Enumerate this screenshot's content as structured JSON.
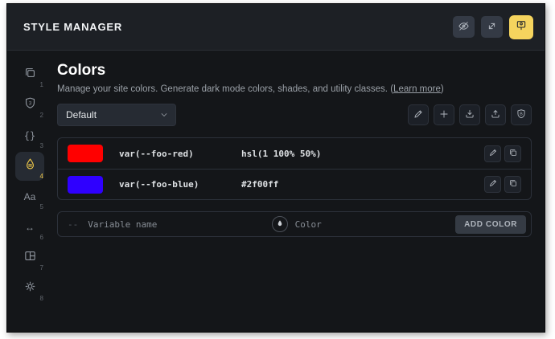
{
  "window": {
    "title": "STYLE MANAGER"
  },
  "topbar": {
    "buttons": [
      {
        "icon": "eye-off-icon",
        "active": false
      },
      {
        "icon": "expand-icon",
        "active": false
      },
      {
        "icon": "brush-icon",
        "active": true
      }
    ]
  },
  "sidebar": {
    "items": [
      {
        "icon": "layers-copy-icon",
        "number": "1"
      },
      {
        "icon": "shield-3-icon",
        "number": "2"
      },
      {
        "icon": "braces-icon",
        "glyph": "{}",
        "number": "3"
      },
      {
        "icon": "droplet-icon",
        "number": "4",
        "active": true
      },
      {
        "icon": "typography-icon",
        "glyph": "Aa",
        "number": "5"
      },
      {
        "icon": "spacing-icon",
        "glyph": "↔",
        "number": "6"
      },
      {
        "icon": "grid-icon",
        "number": "7"
      },
      {
        "icon": "gear-icon",
        "number": "8"
      }
    ]
  },
  "main": {
    "title": "Colors",
    "description_prefix": "Manage your site colors. Generate dark mode colors, shades, and utility classes. (",
    "learn_more": "Learn more",
    "description_suffix": ")",
    "theme_select": {
      "value": "Default"
    },
    "tools": [
      "pencil-icon",
      "plus-icon",
      "import-icon",
      "export-icon",
      "shield-icon"
    ],
    "rows": [
      {
        "variable": "var(--foo-red)",
        "value": "hsl(1 100% 50%)",
        "color": "#ff0000",
        "swatch_css": "background:#ff0000"
      },
      {
        "variable": "var(--foo-blue)",
        "value": "#2f00ff",
        "color": "#2f00ff",
        "swatch_css": "background:#2f00ff"
      }
    ],
    "add_row": {
      "prefix": "--",
      "name_placeholder": "Variable name",
      "color_placeholder": "Color",
      "button": "ADD COLOR"
    }
  },
  "colors": {
    "accent_yellow": "#f5d45e",
    "panel_bg": "#141619",
    "header_bg": "#1d2025"
  }
}
